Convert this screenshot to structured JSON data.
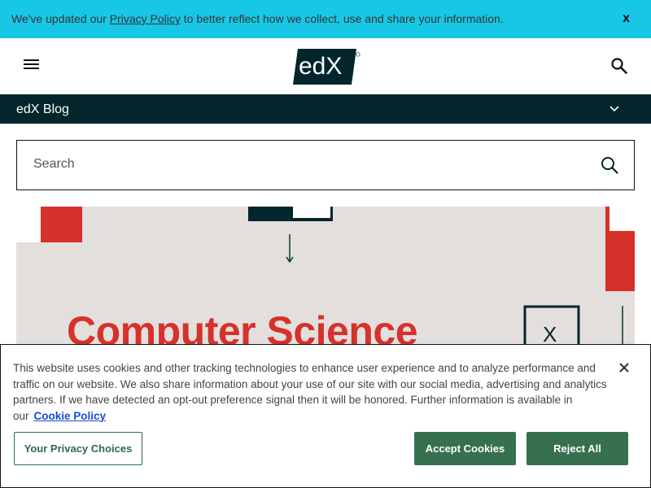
{
  "privacy_banner": {
    "text_before": "We've updated our ",
    "link": "Privacy Policy",
    "text_after": " to better reflect how we collect, use and share your information.",
    "close": "x"
  },
  "header": {
    "logo_text": "edX",
    "menu_icon": "hamburger-menu-icon",
    "search_icon": "search-icon"
  },
  "blog_bar": {
    "title": "edX Blog",
    "chevron_icon": "chevron-down-icon"
  },
  "search": {
    "placeholder": "Search"
  },
  "hero": {
    "headline": "Computer Science",
    "box_letter": "X"
  },
  "cookie_banner": {
    "text": "This website uses cookies and other tracking technologies to enhance user experience and to analyze performance and traffic on our website. We also share information about your use of our site with our social media, advertising and analytics partners. If we have detected an opt-out preference signal then it will be honored. Further information is available in our",
    "link": "Cookie Policy",
    "privacy_choices_label": "Your Privacy Choices",
    "accept_label": "Accept Cookies",
    "reject_label": "Reject All"
  },
  "colors": {
    "banner": "#18c7e6",
    "brand_dark": "#02262b",
    "accent_red": "#d6312b",
    "button_green": "#36704f"
  }
}
